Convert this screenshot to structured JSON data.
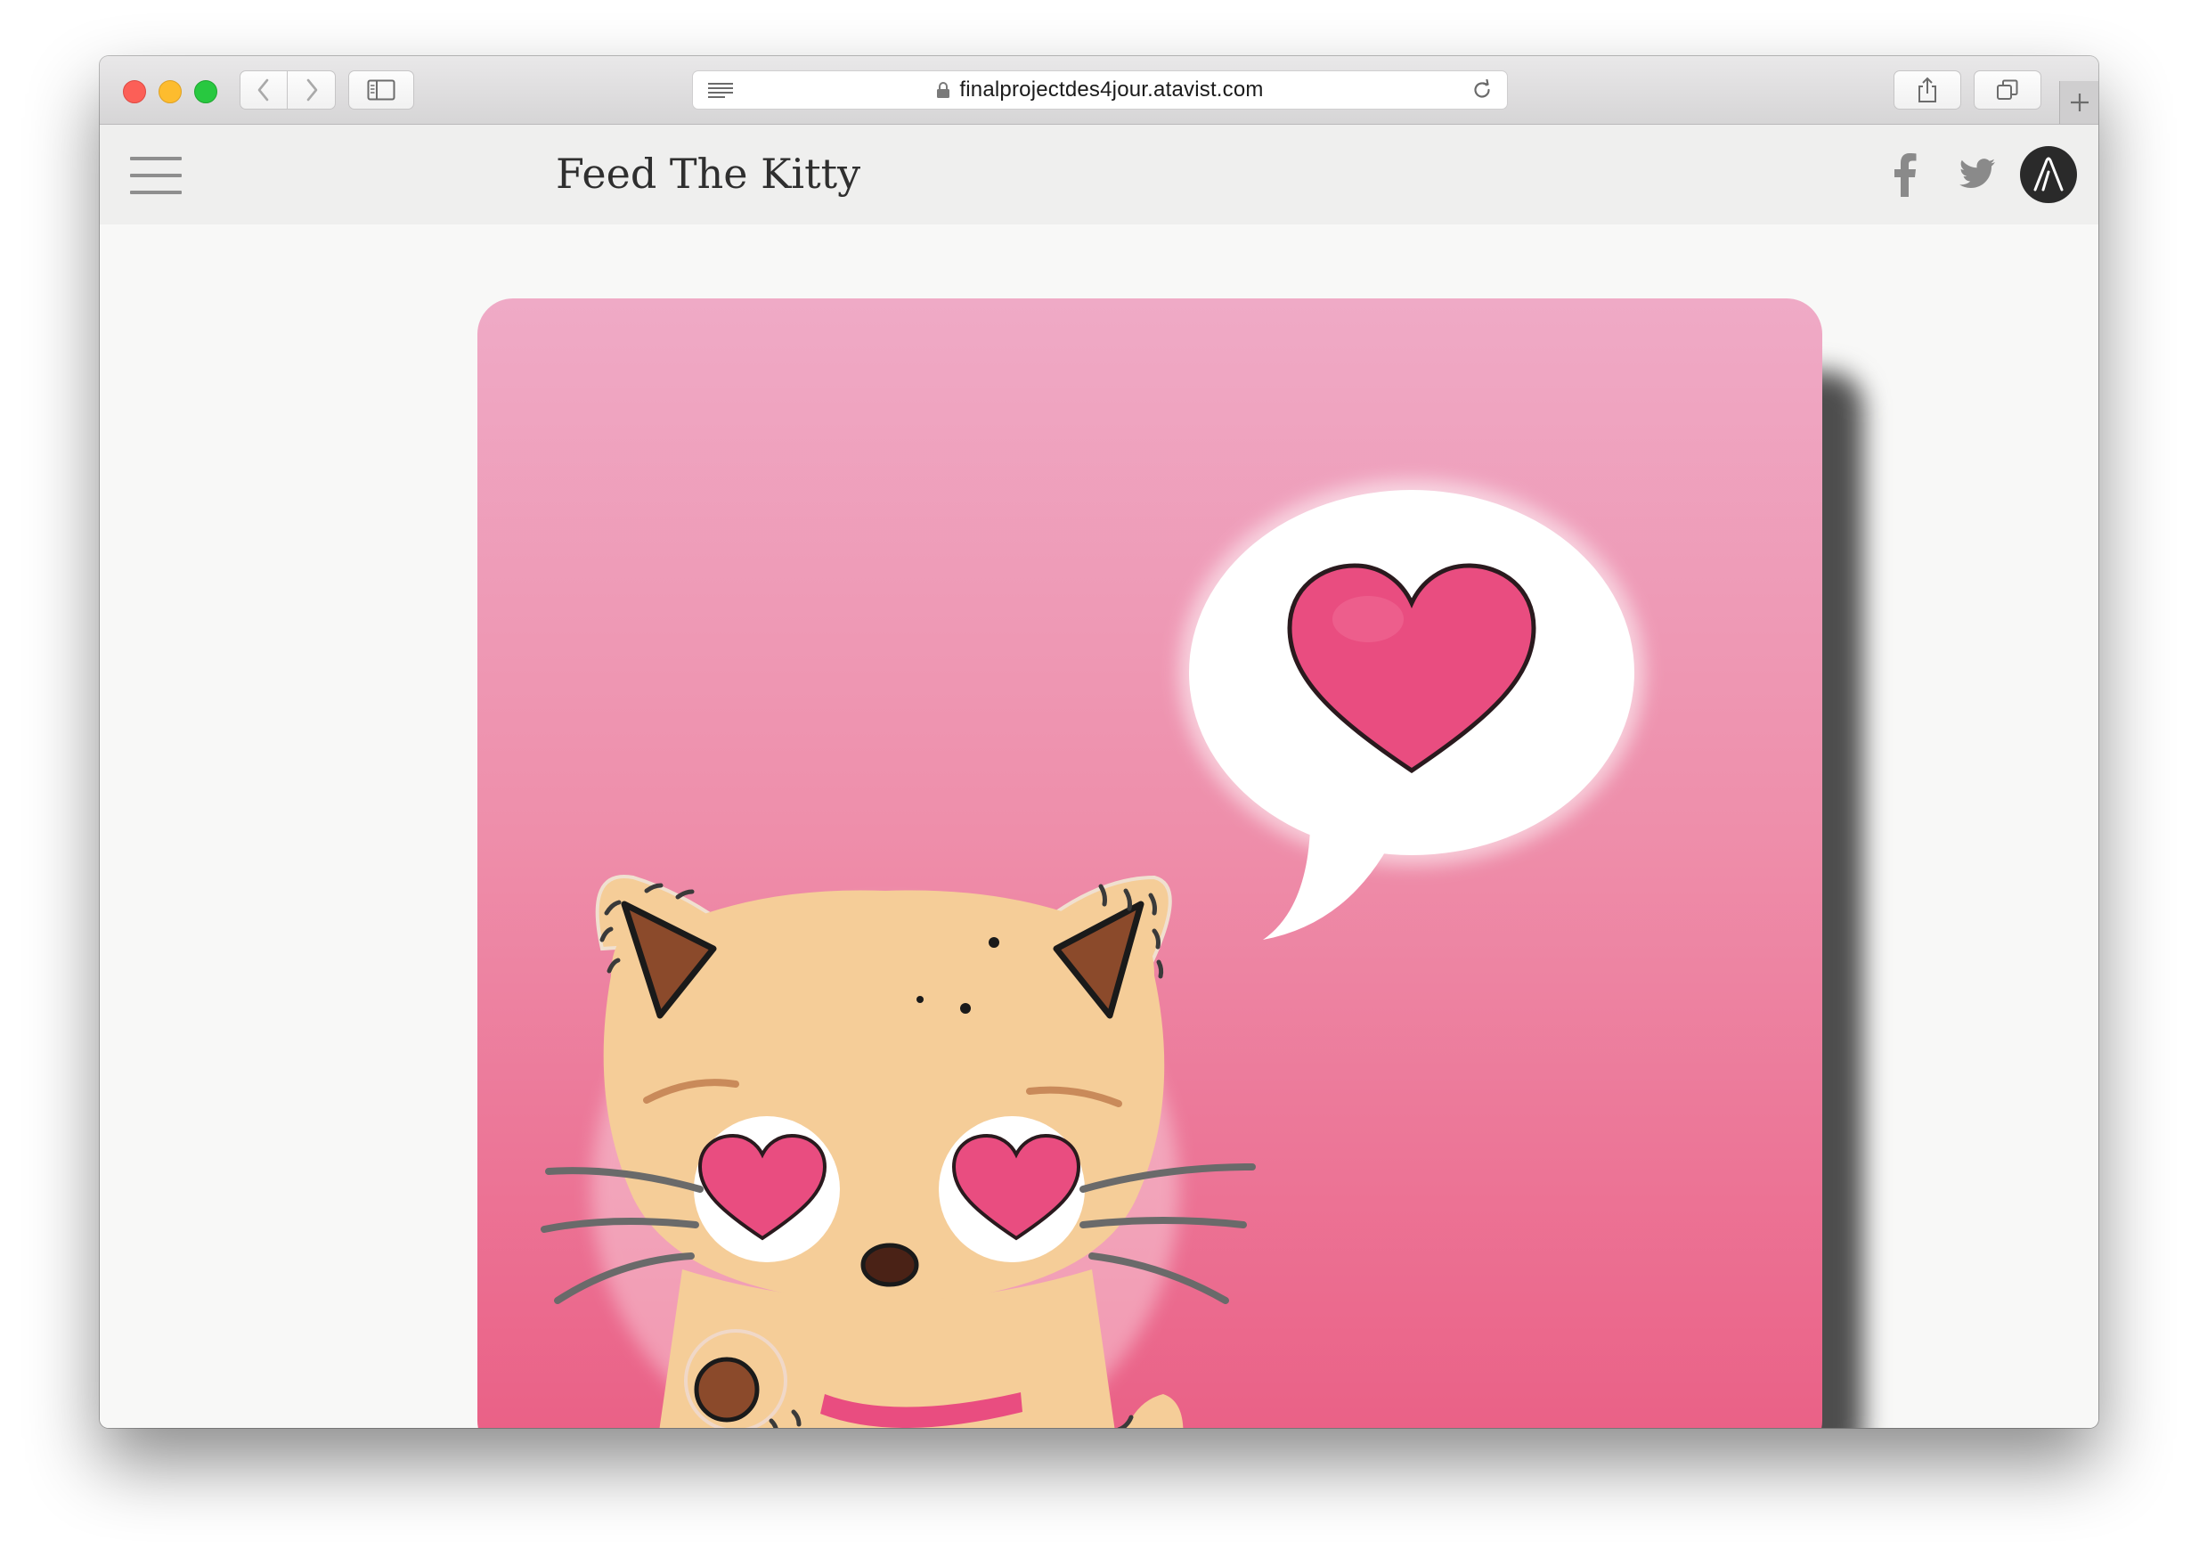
{
  "browser": {
    "url": "finalprojectdes4jour.atavist.com"
  },
  "site": {
    "title": "Feed The Kitty"
  },
  "colors": {
    "accent_pink": "#e94d80",
    "cat_fur": "#f5cd98",
    "header_bg": "#efefee"
  }
}
